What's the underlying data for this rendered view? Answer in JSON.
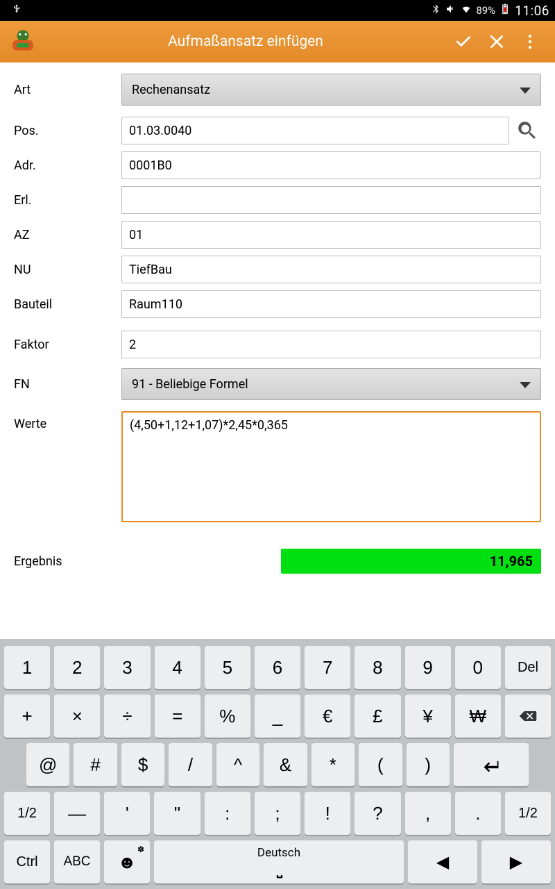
{
  "status": {
    "battery": "89%",
    "clock": "11:06"
  },
  "header": {
    "title": "Aufmaßansatz einfügen"
  },
  "labels": {
    "art": "Art",
    "pos": "Pos.",
    "adr": "Adr.",
    "erl": "Erl.",
    "az": "AZ",
    "nu": "NU",
    "bauteil": "Bauteil",
    "faktor": "Faktor",
    "fn": "FN",
    "werte": "Werte",
    "ergebnis": "Ergebnis"
  },
  "values": {
    "art": "Rechenansatz",
    "pos": "01.03.0040",
    "adr": "0001B0",
    "erl": "",
    "az": "01",
    "nu": "TiefBau",
    "bauteil": "Raum110",
    "faktor": "2",
    "fn": "91 - Beliebige Formel",
    "werte": "(4,50+1,12+1,07)*2,45*0,365",
    "ergebnis": "11,965"
  },
  "keyboard": {
    "r1": [
      "1",
      "2",
      "3",
      "4",
      "5",
      "6",
      "7",
      "8",
      "9",
      "0",
      "Del"
    ],
    "r2": [
      "+",
      "×",
      "÷",
      "=",
      "%",
      "_",
      "€",
      "£",
      "¥",
      "₩"
    ],
    "r3": [
      "@",
      "#",
      "$",
      "/",
      "^",
      "&",
      "*",
      "(",
      ")"
    ],
    "r4_left": "1/2",
    "r4_mid": [
      "—",
      "'",
      "\"",
      ":",
      ";",
      "!",
      "?",
      ",",
      "."
    ],
    "r4_right": "1/2",
    "ctrl": "Ctrl",
    "abc": "ABC",
    "space": "Deutsch",
    "left": "◀",
    "right": "▶"
  }
}
